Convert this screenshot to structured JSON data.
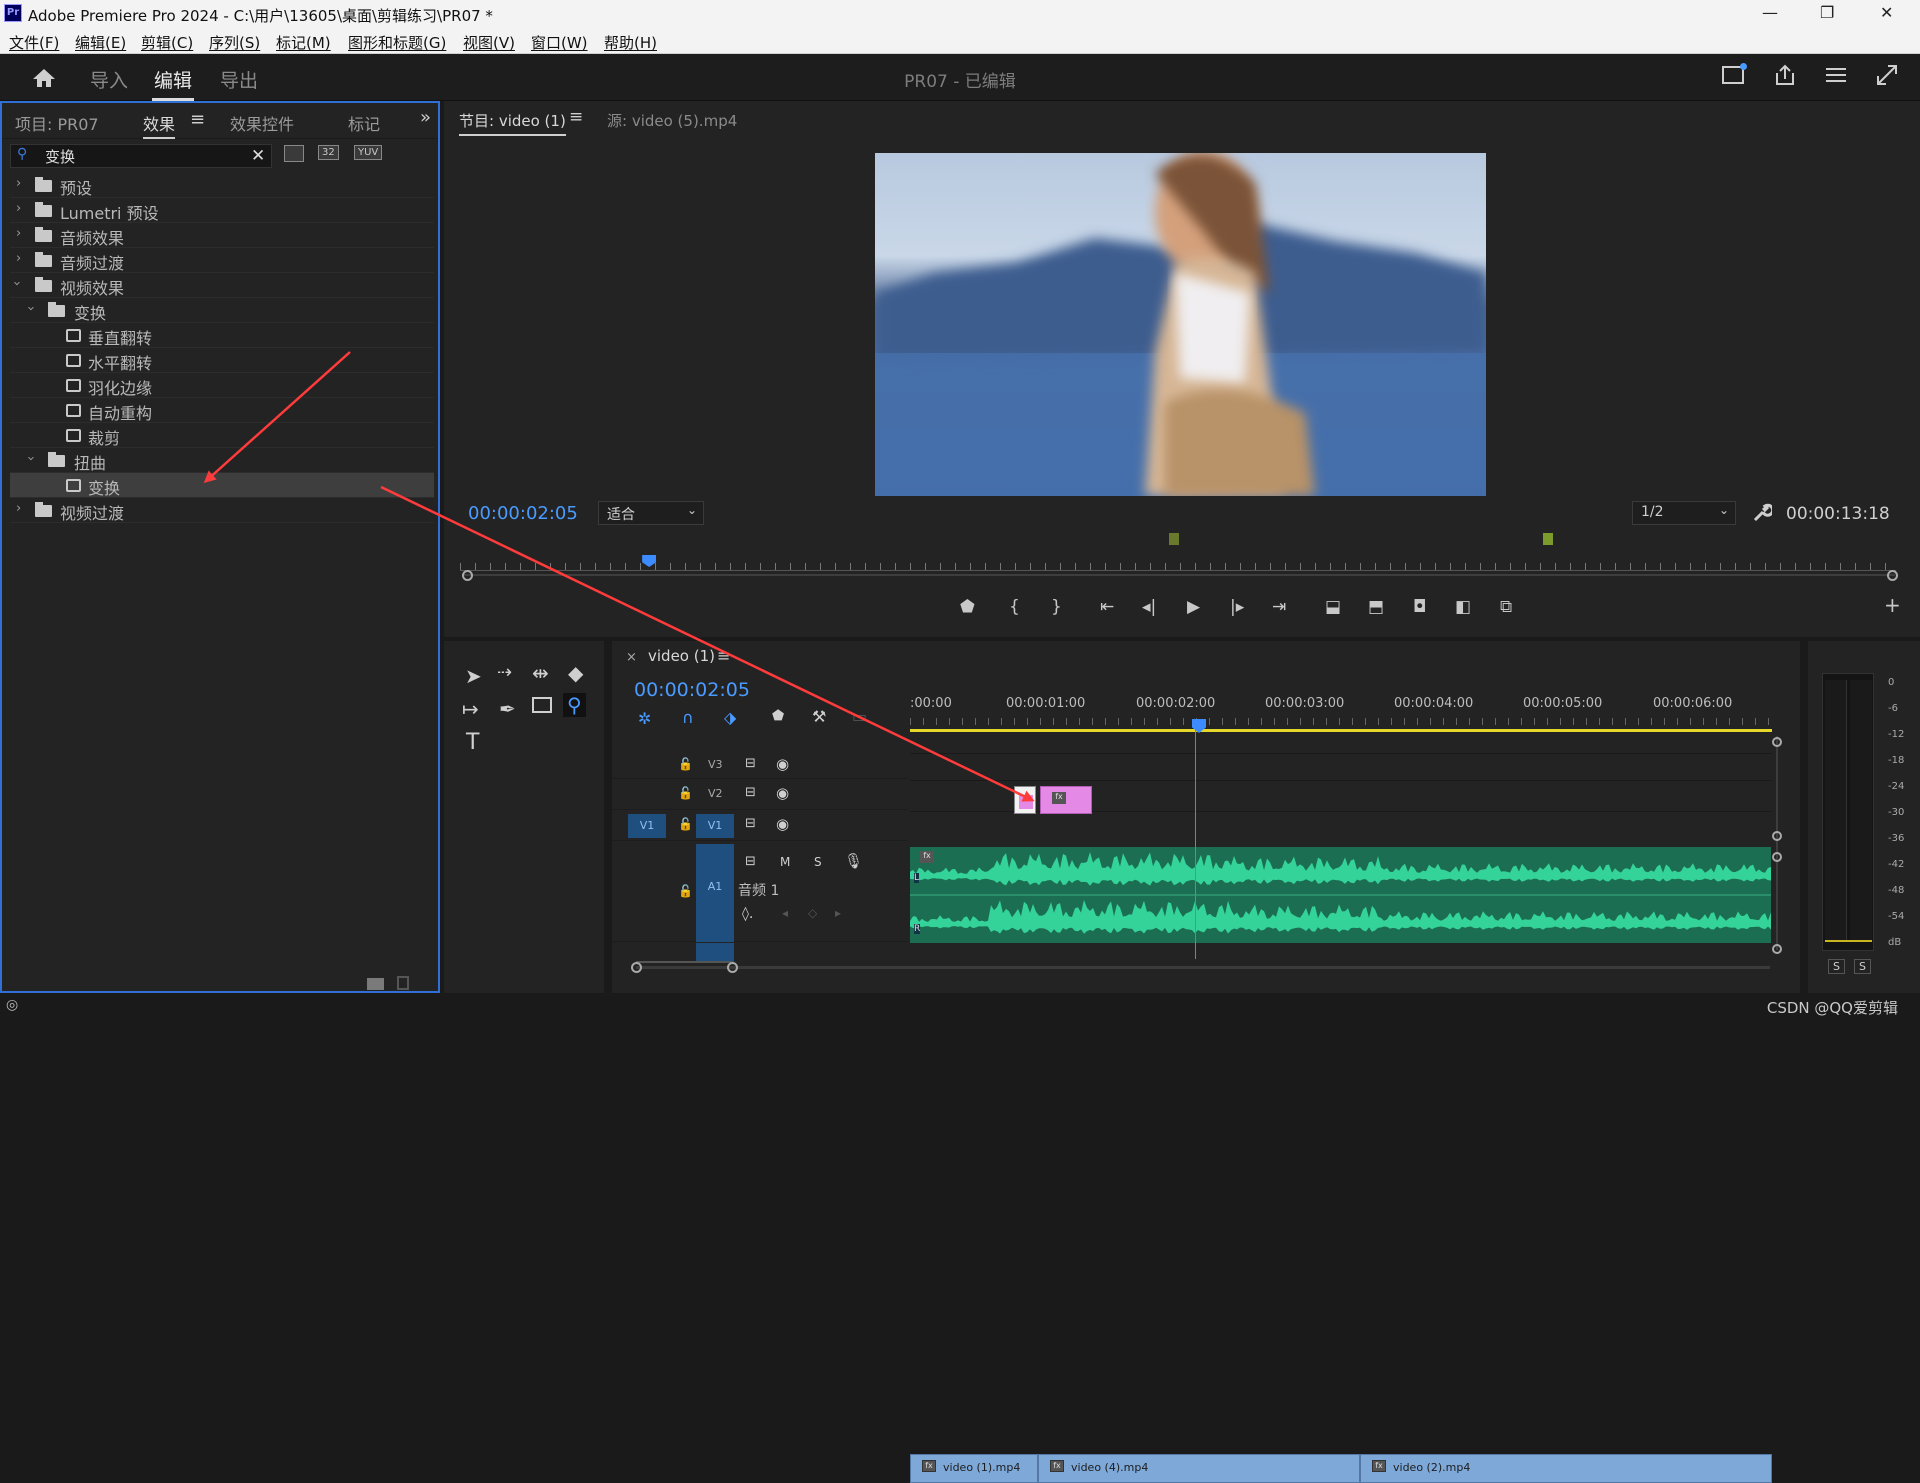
{
  "titlebar": {
    "app": "Adobe Premiere Pro 2024 - C:\\用户\\13605\\桌面\\剪辑练习\\PR07 *",
    "minimize": "—",
    "maximize": "❐",
    "close": "✕"
  },
  "menu": [
    "文件(F)",
    "编辑(E)",
    "剪辑(C)",
    "序列(S)",
    "标记(M)",
    "图形和标题(G)",
    "视图(V)",
    "窗口(W)",
    "帮助(H)"
  ],
  "header": {
    "tabs": [
      "导入",
      "编辑",
      "导出"
    ],
    "active_tab": "编辑",
    "project_title": "PR07 - 已编辑"
  },
  "left_panel": {
    "tabs": [
      "项目: PR07",
      "效果",
      "效果控件",
      "标记"
    ],
    "active_tab": "效果",
    "search": {
      "value": "变换",
      "placeholder": ""
    },
    "badges": [
      "32",
      "YUV"
    ],
    "tree": [
      {
        "label": "预设",
        "level": 0,
        "expanded": false,
        "kind": "folder-star"
      },
      {
        "label": "Lumetri 预设",
        "level": 0,
        "expanded": false,
        "kind": "folder-star"
      },
      {
        "label": "音频效果",
        "level": 0,
        "expanded": false,
        "kind": "folder"
      },
      {
        "label": "音频过渡",
        "level": 0,
        "expanded": false,
        "kind": "folder"
      },
      {
        "label": "视频效果",
        "level": 0,
        "expanded": true,
        "kind": "folder"
      },
      {
        "label": "变换",
        "level": 1,
        "expanded": true,
        "kind": "folder"
      },
      {
        "label": "垂直翻转",
        "level": 2,
        "kind": "effect"
      },
      {
        "label": "水平翻转",
        "level": 2,
        "kind": "effect"
      },
      {
        "label": "羽化边缘",
        "level": 2,
        "kind": "effect"
      },
      {
        "label": "自动重构",
        "level": 2,
        "kind": "effect"
      },
      {
        "label": "裁剪",
        "level": 2,
        "kind": "effect"
      },
      {
        "label": "扭曲",
        "level": 1,
        "expanded": true,
        "kind": "folder"
      },
      {
        "label": "变换",
        "level": 2,
        "kind": "effect",
        "selected": true
      },
      {
        "label": "视频过渡",
        "level": 0,
        "expanded": false,
        "kind": "folder"
      }
    ]
  },
  "program_monitor": {
    "tabs": [
      "节目: video (1)",
      "源: video (5).mp4"
    ],
    "active_tab": "节目: video (1)",
    "timecode": "00:00:02:05",
    "fit": "适合",
    "resolution": "1/2",
    "duration": "00:00:13:18",
    "playhead_fraction": 0.13
  },
  "timeline": {
    "sequence_tab": "video (1)",
    "timecode": "00:00:02:05",
    "ruler_labels": [
      ":00:00",
      "00:00:01:00",
      "00:00:02:00",
      "00:00:03:00",
      "00:00:04:00",
      "00:00:05:00",
      "00:00:06:00"
    ],
    "tracks": {
      "v3": "V3",
      "v2": "V2",
      "v1_source": "V1",
      "v1": "V1",
      "a1": "A1",
      "a1_name": "音频 1",
      "m": "M",
      "s": "S"
    },
    "clips": [
      "video (1).mp4",
      "video (4).mp4",
      "video (2).mp4"
    ],
    "clip_fx": "fx",
    "audio_lr": [
      "L",
      "R"
    ]
  },
  "meter": {
    "scale": [
      "0",
      "-6",
      "-12",
      "-18",
      "-24",
      "-30",
      "-36",
      "-42",
      "-48",
      "-54",
      "dB"
    ],
    "solo": [
      "S",
      "S"
    ]
  },
  "watermark": "CSDN @QQ爱剪辑",
  "colors": {
    "accent": "#2f6fd6",
    "timecode": "#4a9bff",
    "video_clip": "#7ea8d8",
    "audio_clip": "#1c6e52",
    "v2_clip": "#e48ae6",
    "annotation_arrow": "#ff3b3b"
  }
}
